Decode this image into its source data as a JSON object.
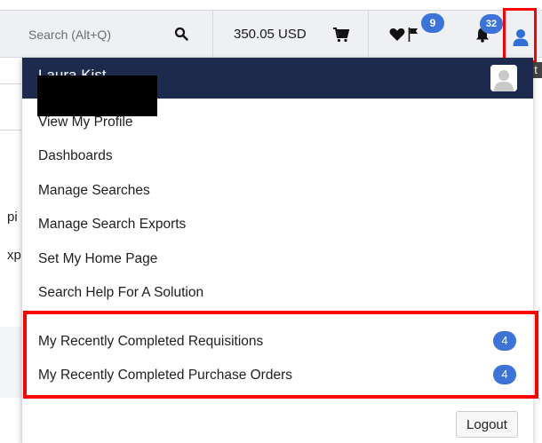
{
  "header": {
    "search_placeholder": "Search (Alt+Q)",
    "balance": "350.05 USD",
    "flag_count": "9",
    "notification_count": "32"
  },
  "background_fragments": {
    "frag_1": "pi",
    "frag_2": "xp",
    "tooltip_char": "t"
  },
  "user_menu": {
    "user_name": "Laura Kist",
    "items": [
      "View My Profile",
      "Dashboards",
      "Manage Searches",
      "Manage Search Exports",
      "Set My Home Page",
      "Search Help For A Solution"
    ],
    "recent": [
      {
        "label": "My Recently Completed Requisitions",
        "count": "4"
      },
      {
        "label": "My Recently Completed Purchase Orders",
        "count": "4"
      }
    ],
    "logout_label": "Logout"
  },
  "colors": {
    "header_bg": "#eef0f3",
    "dropdown_header_bg": "#1d2a4d",
    "badge_blue": "#3b73d9",
    "highlight_red": "#ff0000"
  }
}
